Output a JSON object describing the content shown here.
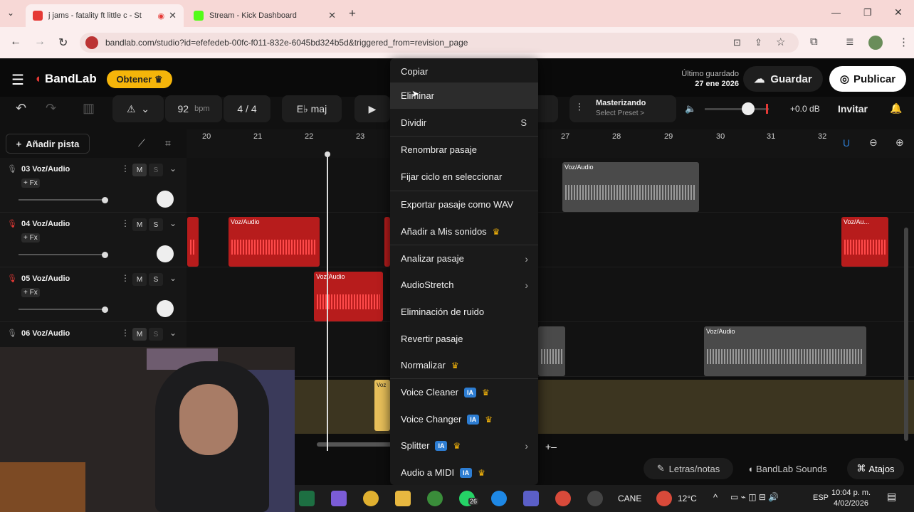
{
  "browser": {
    "tabs": [
      {
        "title": "j jams - fatality ft little c - St",
        "active": true
      },
      {
        "title": "Stream - Kick Dashboard",
        "active": false
      }
    ],
    "url": "bandlab.com/studio?id=efefedeb-00fc-f011-832e-6045bd324b5d&triggered_from=revision_page"
  },
  "header": {
    "logo": "BandLab",
    "obtener": "Obtener",
    "saved_label": "Último guardado",
    "saved_date": "27 ene 2026",
    "guardar": "Guardar",
    "publicar": "Publicar"
  },
  "toolbar": {
    "bpm": "92",
    "bpm_unit": "bpm",
    "time_sig": "4 / 4",
    "key": "E♭ maj",
    "mastering_title": "Masterizando",
    "mastering_preset": "Select Preset >",
    "db": "+0.0 dB",
    "invitar": "Invitar",
    "volume_level": 0.7
  },
  "timeline": {
    "add_track": "Añadir pista",
    "ruler": [
      "20",
      "21",
      "22",
      "23",
      "27",
      "28",
      "29",
      "30",
      "31",
      "32"
    ]
  },
  "tracks": [
    {
      "name": "03 Voz/Audio",
      "fx": "+ Fx",
      "mute": "M",
      "solo": "S"
    },
    {
      "name": "04 Voz/Audio",
      "fx": "+ Fx",
      "mute": "M",
      "solo": "S"
    },
    {
      "name": "05 Voz/Audio",
      "fx": "+ Fx",
      "mute": "M",
      "solo": "S"
    },
    {
      "name": "06 Voz/Audio",
      "fx": "+ Fx",
      "mute": "M",
      "solo": "S"
    }
  ],
  "clips": {
    "label": "Voz/Audio",
    "label_short": "Voz/Au...",
    "label_tiny": "Voz"
  },
  "context_menu": {
    "items": [
      {
        "label": "Copiar"
      },
      {
        "label": "Eliminar"
      },
      {
        "label": "Dividir",
        "shortcut": "S"
      },
      {
        "label": "Renombrar pasaje"
      },
      {
        "label": "Fijar ciclo en seleccionar"
      },
      {
        "label": "Exportar pasaje como WAV"
      },
      {
        "label": "Añadir a Mis sonidos"
      },
      {
        "label": "Analizar pasaje"
      },
      {
        "label": "AudioStretch"
      },
      {
        "label": "Eliminación de ruido"
      },
      {
        "label": "Revertir pasaje"
      },
      {
        "label": "Normalizar"
      },
      {
        "label": "Voice Cleaner"
      },
      {
        "label": "Voice Changer"
      },
      {
        "label": "Splitter"
      },
      {
        "label": "Audio a MIDI"
      }
    ],
    "ia_badge": "IA",
    "crown": "♛"
  },
  "bottom": {
    "letras": "Letras/notas",
    "sounds": "BandLab Sounds",
    "atajos": "Atajos"
  },
  "taskbar": {
    "badge": "26",
    "weather_place": "CANE",
    "temp": "12°C",
    "lang": "ESP",
    "time": "10:04 p. m.",
    "date": "4/02/2026"
  },
  "colors": {
    "accent_yellow": "#f5b50a",
    "clip_red": "#b71c1c",
    "ia_blue": "#2d7dd2"
  }
}
